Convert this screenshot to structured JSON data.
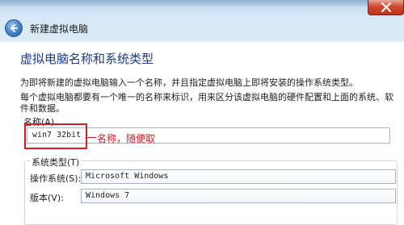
{
  "window": {
    "title": "新建虚拟电脑",
    "close_icon": "close-icon",
    "back_icon": "back-arrow-icon"
  },
  "page": {
    "header": "虚拟电脑名称和系统类型",
    "intro": "为即将新建的虚拟电脑输入一个名称，并且指定虚拟电脑上即将安装的操作系统类型。",
    "description": "每个虚拟电脑都要有一个唯一的名称来标识，用来区分该虚拟电脑的硬件配置和上面的系统、软件和数据。"
  },
  "name": {
    "label": "名称(A)",
    "value": "win7 32bit",
    "annotation": "名称，随便取"
  },
  "system_type": {
    "group_title": "系统类型(T)",
    "os_label": "操作系统(S):",
    "os_value": "Microsoft Windows",
    "version_label": "版本(V):",
    "version_value": "Windows 7"
  },
  "colors": {
    "accent_title": "#1d3c88",
    "annotation_red": "#d41e22",
    "glass": "#c9def1"
  }
}
